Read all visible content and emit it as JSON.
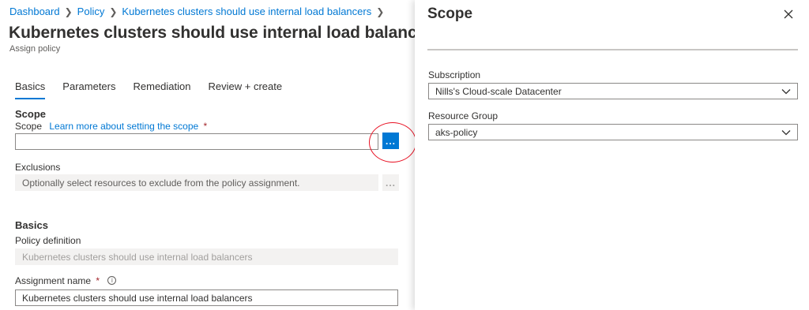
{
  "breadcrumb": {
    "items": [
      "Dashboard",
      "Policy",
      "Kubernetes clusters should use internal load balancers"
    ]
  },
  "page": {
    "title": "Kubernetes clusters should use internal load balancers",
    "subtitle": "Assign policy"
  },
  "tabs": [
    "Basics",
    "Parameters",
    "Remediation",
    "Review + create"
  ],
  "form": {
    "scope_section": "Scope",
    "scope_label": "Scope",
    "scope_link": "Learn more about setting the scope",
    "required_mark": "*",
    "scope_value": "",
    "browse_label": "...",
    "exclusions_label": "Exclusions",
    "exclusions_placeholder": "Optionally select resources to exclude from the policy assignment.",
    "basics_section": "Basics",
    "policy_definition_label": "Policy definition",
    "policy_definition_value": "Kubernetes clusters should use internal load balancers",
    "assignment_name_label": "Assignment name",
    "assignment_name_value": "Kubernetes clusters should use internal load balancers",
    "info_glyph": "i"
  },
  "panel": {
    "title": "Scope",
    "subscription_label": "Subscription",
    "subscription_value": "Nills's Cloud-scale Datacenter",
    "resource_group_label": "Resource Group",
    "resource_group_value": "aks-policy"
  },
  "colors": {
    "accent": "#0078d4",
    "highlight_circle": "#e81123",
    "required": "#a4262c"
  }
}
